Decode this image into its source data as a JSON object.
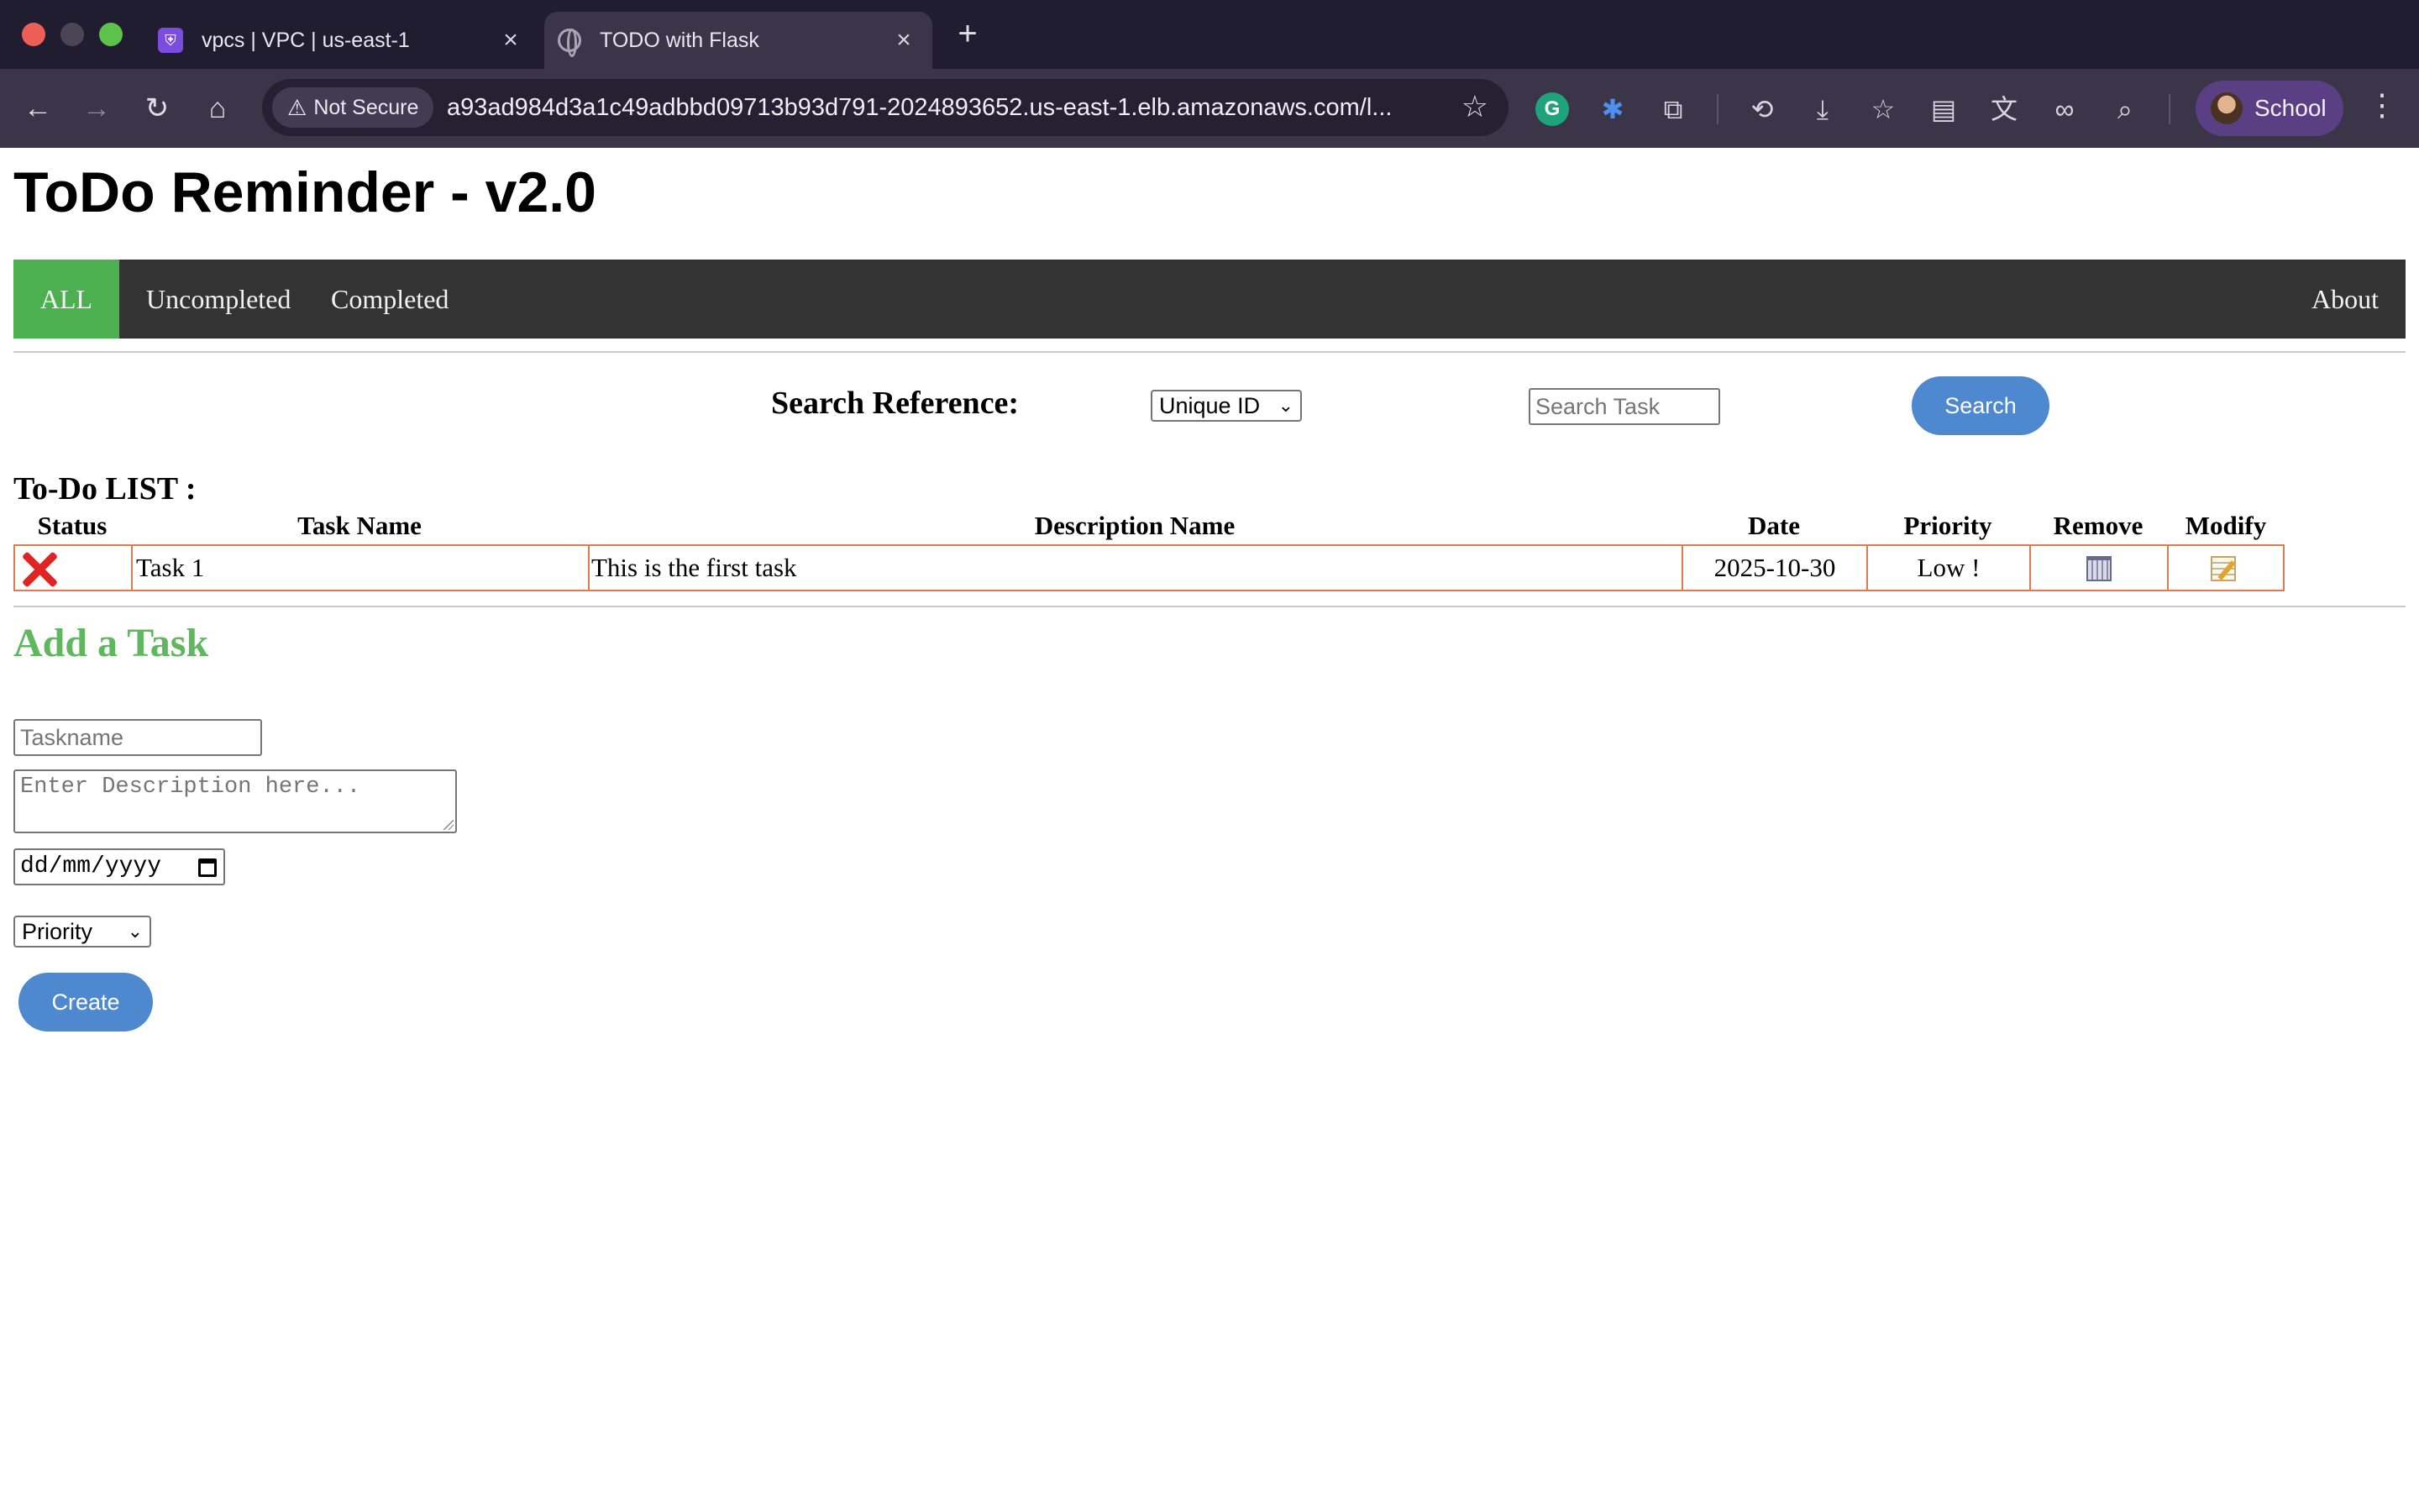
{
  "browser": {
    "tabs": [
      {
        "title": "vpcs | VPC | us-east-1",
        "icon": "vpc-console-icon",
        "active": false
      },
      {
        "title": "TODO with Flask",
        "icon": "globe-icon",
        "active": true
      }
    ],
    "security_label": "Not Secure",
    "url": "a93ad984d3a1c49adbbd09713b93d791-2024893652.us-east-1.elb.amazonaws.com/l...",
    "profile_name": "School"
  },
  "app": {
    "title": "ToDo Reminder - v2.0"
  },
  "nav": {
    "items": [
      "ALL",
      "Uncompleted",
      "Completed"
    ],
    "active": "ALL",
    "about": "About"
  },
  "search": {
    "label": "Search Reference:",
    "select_value": "Unique ID",
    "placeholder": "Search Task",
    "button": "Search"
  },
  "todo": {
    "title": "To-Do LIST :",
    "columns": [
      "Status",
      "Task Name",
      "Description Name",
      "Date",
      "Priority",
      "Remove",
      "Modify"
    ],
    "rows": [
      {
        "status_icon": "cross-mark-icon",
        "task": "Task 1",
        "description": "This is the first task",
        "date": "2025-10-30",
        "priority": "Low !",
        "remove_icon": "trash-icon",
        "modify_icon": "memo-icon"
      }
    ]
  },
  "add_task": {
    "title": "Add a Task",
    "taskname_placeholder": "Taskname",
    "description_placeholder": "Enter Description here...",
    "date_placeholder": "dd/mm/yyyy",
    "priority_value": "Priority",
    "create_button": "Create"
  },
  "colors": {
    "nav_bg": "#333333",
    "nav_active": "#4caf50",
    "button": "#4e88cf",
    "add_title": "#5fb760",
    "row_border": "#e07b4f"
  }
}
